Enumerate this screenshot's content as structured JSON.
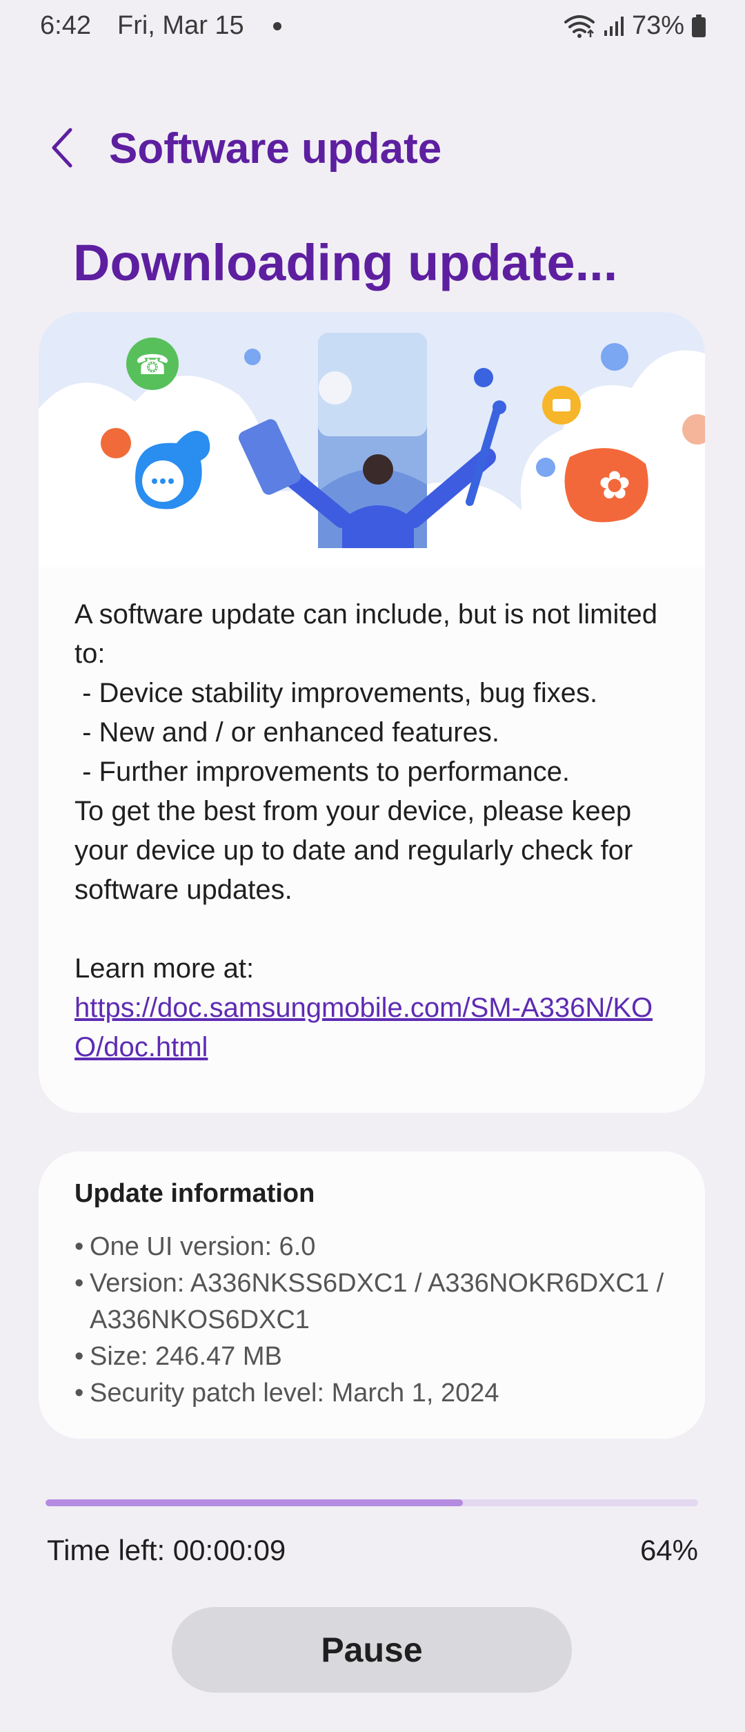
{
  "status_bar": {
    "time": "6:42",
    "date": "Fri, Mar 15",
    "battery": "73%",
    "icons": [
      "wifi-icon",
      "signal-icon",
      "battery-icon"
    ]
  },
  "header": {
    "back_icon": "back-arrow-icon",
    "title": "Software update"
  },
  "page_heading": "Downloading update...",
  "description": {
    "text": "A software update can include, but is not limited to:\n - Device stability improvements, bug fixes.\n - New and / or enhanced features.\n - Further improvements to performance.\nTo get the best from your device, please keep your device up to date and regularly check for software updates.\n\nLearn more at:",
    "link": "https://doc.samsungmobile.com/SM-A336N/KOO/doc.html"
  },
  "update_info": {
    "title": "Update information",
    "items": [
      "One UI version: 6.0",
      "Version: A336NKSS6DXC1 / A336NOKR6DXC1 / A336NKOS6DXC1",
      "Size: 246.47 MB",
      "Security patch level: March 1, 2024"
    ]
  },
  "progress": {
    "fraction": 0.64,
    "time_left": "Time left: 00:00:09",
    "percent": "64%"
  },
  "pause_label": "Pause",
  "colors": {
    "accent": "#5d1fa0",
    "link": "#5d2bb3",
    "progress_fill": "#b48be0",
    "progress_track": "#e3d8f0",
    "background": "#f1eff4"
  }
}
